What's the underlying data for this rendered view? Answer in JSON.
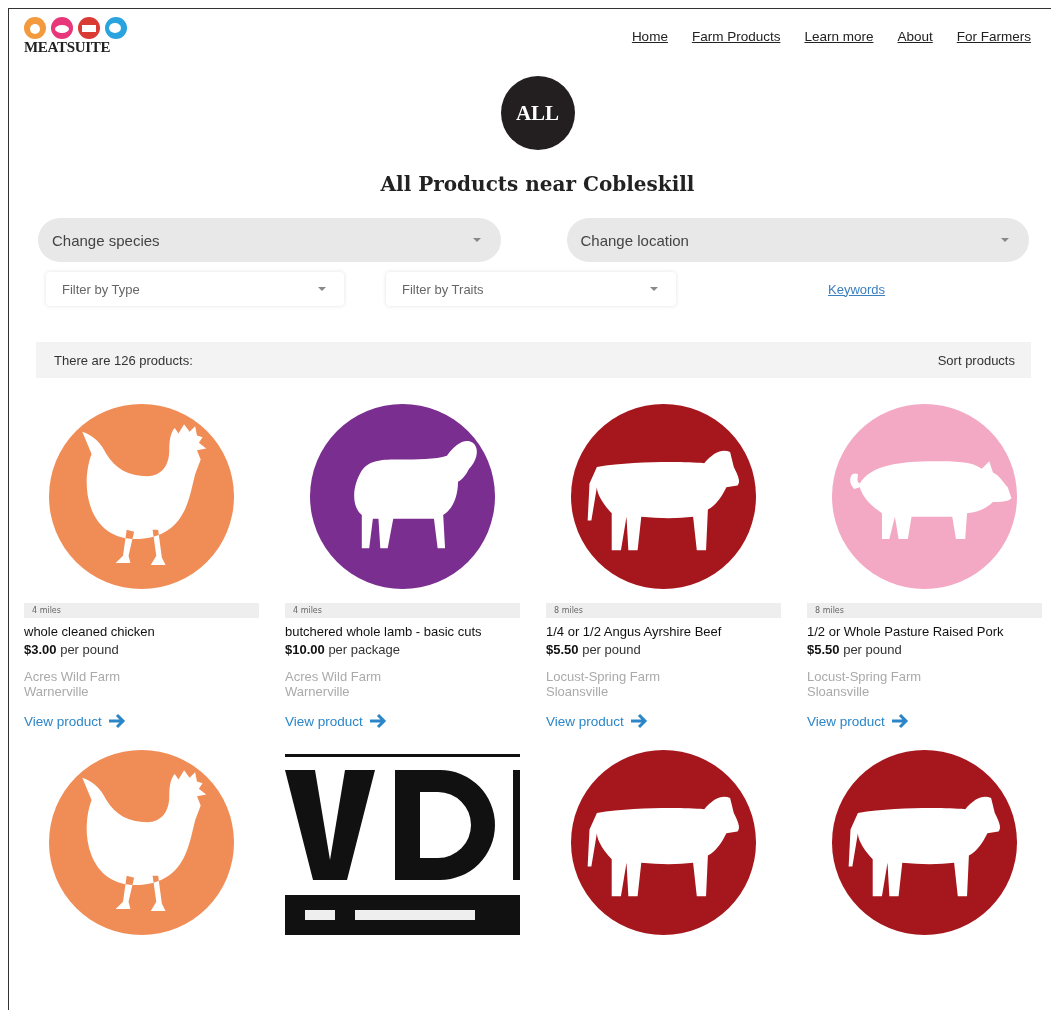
{
  "logo": {
    "text": "MEATSUITE"
  },
  "nav": [
    "Home",
    "Farm Products",
    "Learn more",
    "About",
    "For Farmers"
  ],
  "badge": "ALL",
  "title": "All Products near Cobleskill",
  "selects": [
    "Change species",
    "Change location"
  ],
  "filters": [
    {
      "kind": "select",
      "text": "Filter by Type"
    },
    {
      "kind": "select",
      "text": "Filter by Traits"
    },
    {
      "kind": "link",
      "text": "Keywords"
    }
  ],
  "summary": {
    "count": "There are 126 products:",
    "sort": "Sort products"
  },
  "products": [
    {
      "kind": "chicken",
      "distance": "4 miles",
      "name": "whole cleaned chicken",
      "price": "$3.00",
      "unit": "per pound",
      "farm": "Acres Wild Farm",
      "town": "Warnerville",
      "link": "View product"
    },
    {
      "kind": "lamb",
      "distance": "4 miles",
      "name": "butchered whole lamb - basic cuts",
      "price": "$10.00",
      "unit": "per package",
      "farm": "Acres Wild Farm",
      "town": "Warnerville",
      "link": "View product"
    },
    {
      "kind": "beef",
      "distance": "8 miles",
      "name": "1/4 or 1/2 Angus Ayrshire Beef",
      "price": "$5.50",
      "unit": "per pound",
      "farm": "Locust-Spring Farm",
      "town": "Sloansville",
      "link": "View product"
    },
    {
      "kind": "pork",
      "distance": "8 miles",
      "name": "1/2 or Whole Pasture Raised Pork",
      "price": "$5.50",
      "unit": "per pound",
      "farm": "Locust-Spring Farm",
      "town": "Sloansville",
      "link": "View product"
    }
  ],
  "more_products": [
    {
      "kind": "chicken"
    },
    {
      "kind": "picture"
    },
    {
      "kind": "beef"
    },
    {
      "kind": "beef"
    }
  ]
}
